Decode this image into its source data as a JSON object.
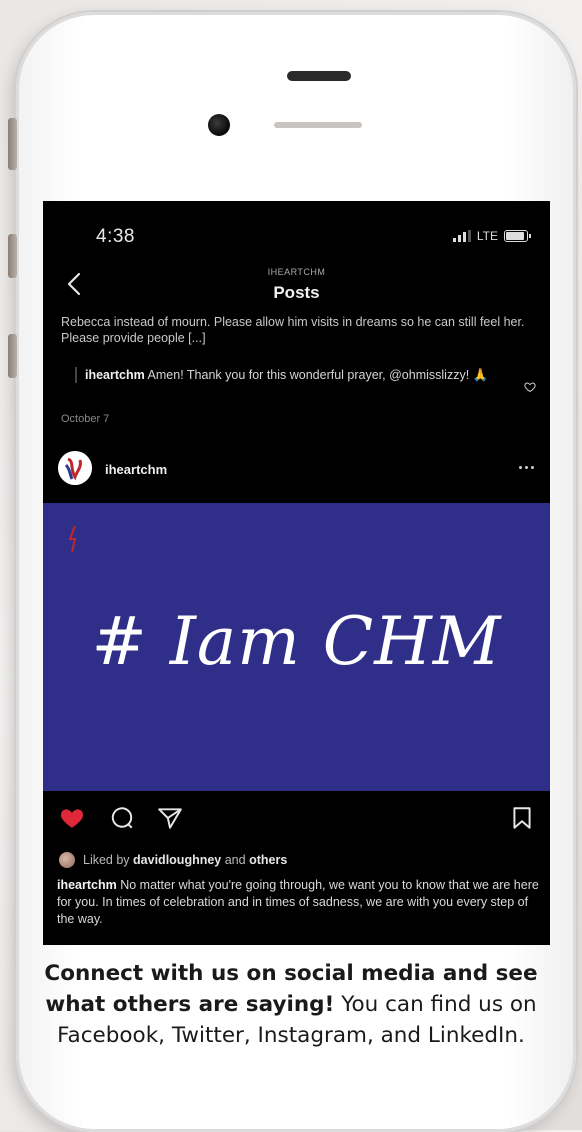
{
  "status_bar": {
    "time": "4:38",
    "network": "LTE"
  },
  "nav": {
    "account_label": "IHEARTCHM",
    "title": "Posts"
  },
  "previous_comment": {
    "text": "Rebecca instead of mourn. Please allow him visits in dreams so he can still feel her. Please provide people [...]"
  },
  "reply": {
    "username": "iheartchm",
    "text": "Amen! Thank you for this wonderful prayer, @ohmisslizzy! 🙏"
  },
  "comment_date": "October 7",
  "post": {
    "username": "iheartchm",
    "image_text": "# Iam CHM",
    "liked_by_prefix": "Liked by",
    "liked_by_user": "davidloughney",
    "liked_by_and": "and",
    "liked_by_others": "others",
    "caption_username": "iheartchm",
    "caption_text": "No matter what you're going through, we want you to know that we are here for you. In times of celebration and in times of sadness, we are with you every step of the way."
  },
  "cta": {
    "bold": "Connect with us on social media and see what others are saying!",
    "normal": "You can find us on Facebook, Twitter, Instagram, and LinkedIn."
  },
  "colors": {
    "post_background": "#2f2f8a",
    "like_heart": "#e0283a",
    "screen_background": "#000000"
  },
  "icons": [
    "back-chevron-icon",
    "heart-icon",
    "comment-icon",
    "share-icon",
    "bookmark-icon",
    "more-icon",
    "signal-icon",
    "battery-icon"
  ]
}
